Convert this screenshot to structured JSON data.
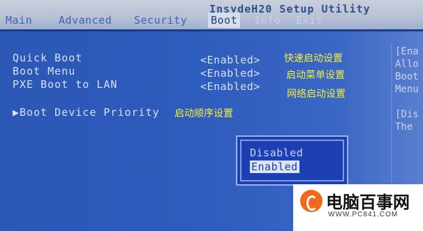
{
  "header": {
    "setup_title": "InsydeH20 Setup Utility",
    "tabs": [
      {
        "label": "Main"
      },
      {
        "label": "Advanced"
      },
      {
        "label": "Security"
      },
      {
        "label": "Boot"
      },
      {
        "label": "Info"
      },
      {
        "label": "Exit"
      }
    ]
  },
  "options": [
    {
      "label": "Quick Boot",
      "value": "<Enabled>",
      "note": "快速启动设置"
    },
    {
      "label": "Boot Menu",
      "value": "<Enabled>",
      "note": "启动菜单设置"
    },
    {
      "label": "PXE Boot to LAN",
      "value": "<Enabled>",
      "note": "网络启动设置"
    }
  ],
  "submenu": {
    "label": "▶Boot Device Priority",
    "note": "启动顺序设置"
  },
  "help_panel": {
    "lines": [
      "[Ena",
      "Allo",
      "Boot",
      "Menu",
      "[Dis",
      "The"
    ]
  },
  "popup": {
    "items": [
      "Disabled",
      "Enabled"
    ],
    "selected": "Enabled"
  },
  "watermark": {
    "brand": "电脑百事网",
    "url": "WWW.PC841.COM"
  },
  "colors": {
    "background": "#2e5cbc",
    "note": "#f3ef3a",
    "popup": "#1c3fb3"
  }
}
